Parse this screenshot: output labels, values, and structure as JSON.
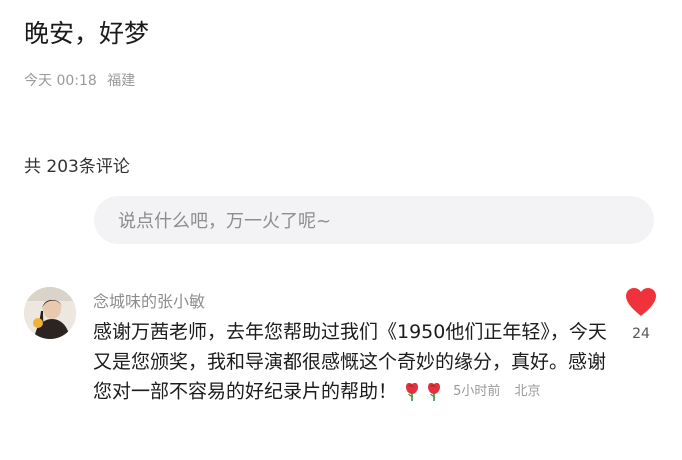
{
  "post": {
    "title": "晚安，好梦",
    "time": "今天 00:18",
    "location": "福建"
  },
  "comments_header": {
    "count_text": "共 203条评论"
  },
  "comment_input": {
    "placeholder": "说点什么吧，万一火了呢~"
  },
  "comment": {
    "username": "念城味的张小敏",
    "text": "感谢万茜老师，去年您帮助过我们《1950他们正年轻》，今天又是您颁奖，我和导演都很感慨这个奇妙的缘分，真好。感谢您对一部不容易的好纪录片的帮助！",
    "time": "5小时前",
    "location": "北京",
    "like_count": "24",
    "colors": {
      "like": "#f0323c",
      "rose": "#e0313c"
    },
    "icons": [
      "rose-icon",
      "rose-icon",
      "heart-icon"
    ]
  }
}
